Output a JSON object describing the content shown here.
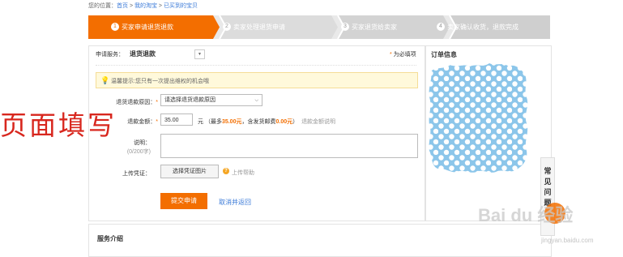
{
  "breadcrumb": {
    "prefix": "您的位置：",
    "items": [
      "首页",
      "我的淘宝",
      "已买到的宝贝"
    ]
  },
  "steps": [
    {
      "num": "1",
      "label": "买家申请退货退款"
    },
    {
      "num": "2",
      "label": "卖家处理退货申请"
    },
    {
      "num": "3",
      "label": "买家退货给卖家"
    },
    {
      "num": "4",
      "label": "卖家确认收货，退款完成"
    }
  ],
  "form": {
    "service_label": "申请服务：",
    "service_value": "退货退款",
    "required_note": "为必填项",
    "tip": "温馨提示:您只有一次提出维权的机会哦",
    "reason_label": "退货退款原因：",
    "reason_placeholder": "请选择退货退款原因",
    "amount_label": "退款金额：",
    "amount_value": "35.00",
    "amount_unit": "元",
    "amount_hint_pre": "（最多",
    "amount_hint_max": "35.00元",
    "amount_hint_mid": "，含发货邮费",
    "amount_hint_postage": "0.00元",
    "amount_hint_post": "）",
    "amount_help": "退款金额说明",
    "desc_label": "说明：",
    "desc_count": "(0/200字)",
    "upload_label": "上传凭证：",
    "upload_button": "选择凭证图片",
    "upload_help": "上传帮助",
    "submit_button": "提交申请",
    "cancel_link": "取消并返回"
  },
  "sidebar": {
    "title": "订单信息"
  },
  "bottom": {
    "title": "服务介绍"
  },
  "side_tab": {
    "chars": [
      "常",
      "见",
      "问",
      "题"
    ]
  },
  "overlay": {
    "handwriting": "页面填写"
  },
  "watermark": {
    "brand": "Bai du 经验",
    "url": "jingyan.baidu.com"
  },
  "colors": {
    "accent": "#f36e00",
    "link": "#3c7bd8",
    "polka_bg": "#8cc6ea"
  }
}
